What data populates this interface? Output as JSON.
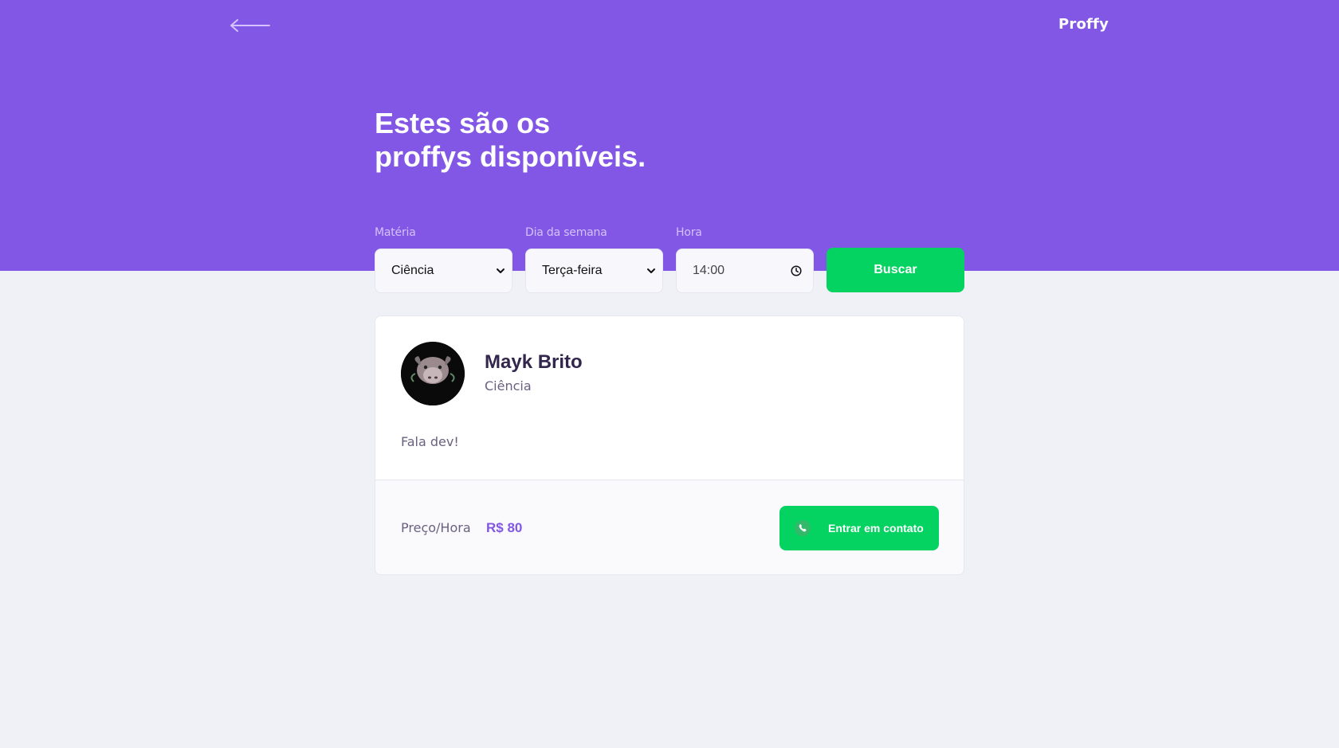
{
  "header": {
    "brand": "Proffy",
    "back_icon": "arrow-left-icon",
    "title_line1": "Estes são os",
    "title_line2": "proffys disponíveis."
  },
  "filters": {
    "subject": {
      "label": "Matéria",
      "value": "Ciência"
    },
    "weekday": {
      "label": "Dia da semana",
      "value": "Terça-feira"
    },
    "time": {
      "label": "Hora",
      "value": "14:00"
    },
    "search_button": "Buscar"
  },
  "teachers": [
    {
      "name": "Mayk Brito",
      "subject": "Ciência",
      "bio": "Fala dev!",
      "price_label": "Preço/Hora",
      "price": "R$ 80",
      "contact_button": "Entrar em contato",
      "contact_icon": "whatsapp-icon"
    }
  ],
  "colors": {
    "primary": "#8257E5",
    "secondary": "#04D361",
    "background": "#F0F0F7",
    "title": "#32264D",
    "text": "#6A6180"
  }
}
